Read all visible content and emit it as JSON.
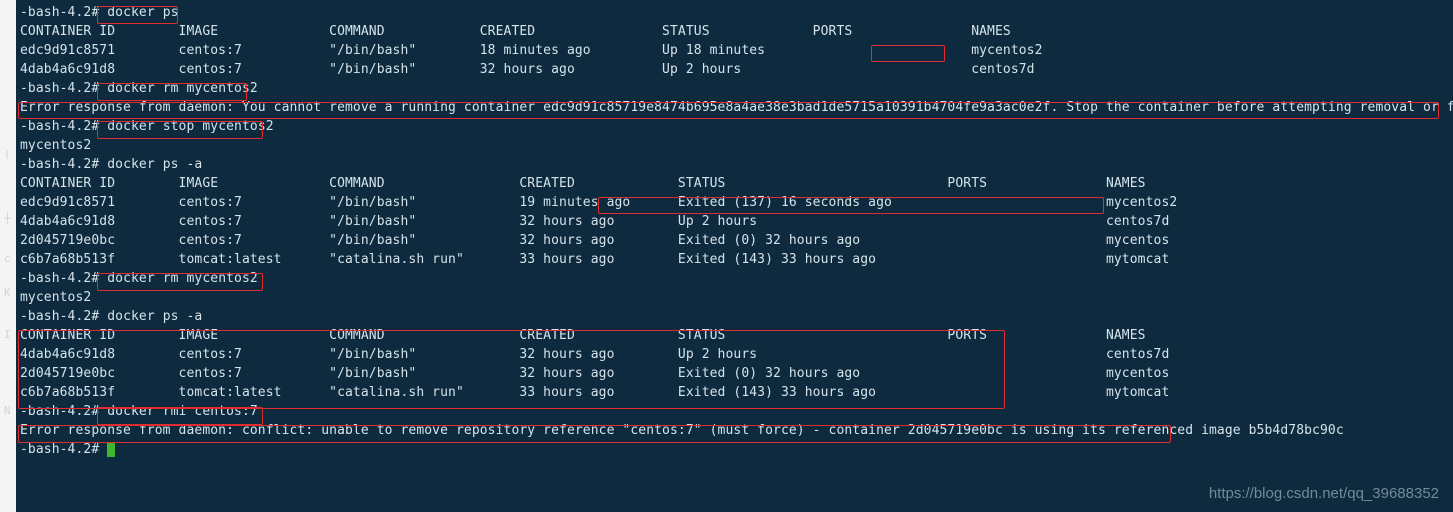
{
  "prompt": "-bash-4.2#",
  "commands": {
    "ps": "docker ps",
    "rm1": "docker rm mycentos2",
    "stop": "docker stop mycentos2",
    "psa1": "docker ps -a",
    "rm2": "docker rm mycentos2",
    "psa2": "docker ps -a",
    "rmi": "docker rmi centos:7"
  },
  "outputs": {
    "rm_stop_echo": "mycentos2",
    "err1": "Error response from daemon: You cannot remove a running container edc9d91c85719e8474b695e8a4ae38e3bad1de5715a10391b4704fe9a3ac0e2f. Stop the container before attempting removal or force remove",
    "err2": "Error response from daemon: conflict: unable to remove repository reference \"centos:7\" (must force) - container 2d045719e0bc is using its referenced image b5b4d78bc90c"
  },
  "columns1": {
    "c0": "CONTAINER ID",
    "c1": "IMAGE",
    "c2": "COMMAND",
    "c3": "CREATED",
    "c4": "STATUS",
    "c5": "PORTS",
    "c6": "NAMES"
  },
  "table1": [
    {
      "c0": "edc9d91c8571",
      "c1": "centos:7",
      "c2": "\"/bin/bash\"",
      "c3": "18 minutes ago",
      "c4": "Up 18 minutes",
      "c5": "",
      "c6": "mycentos2"
    },
    {
      "c0": "4dab4a6c91d8",
      "c1": "centos:7",
      "c2": "\"/bin/bash\"",
      "c3": "32 hours ago",
      "c4": "Up 2 hours",
      "c5": "",
      "c6": "centos7d"
    }
  ],
  "columns2": {
    "c0": "CONTAINER ID",
    "c1": "IMAGE",
    "c2": "COMMAND",
    "c3": "CREATED",
    "c4": "STATUS",
    "c5": "PORTS",
    "c6": "NAMES"
  },
  "table2": [
    {
      "c0": "edc9d91c8571",
      "c1": "centos:7",
      "c2": "\"/bin/bash\"",
      "c3": "19 minutes ago",
      "c4": "Exited (137) 16 seconds ago",
      "c5": "",
      "c6": "mycentos2"
    },
    {
      "c0": "4dab4a6c91d8",
      "c1": "centos:7",
      "c2": "\"/bin/bash\"",
      "c3": "32 hours ago",
      "c4": "Up 2 hours",
      "c5": "",
      "c6": "centos7d"
    },
    {
      "c0": "2d045719e0bc",
      "c1": "centos:7",
      "c2": "\"/bin/bash\"",
      "c3": "32 hours ago",
      "c4": "Exited (0) 32 hours ago",
      "c5": "",
      "c6": "mycentos"
    },
    {
      "c0": "c6b7a68b513f",
      "c1": "tomcat:latest",
      "c2": "\"catalina.sh run\"",
      "c3": "33 hours ago",
      "c4": "Exited (143) 33 hours ago",
      "c5": "",
      "c6": "mytomcat"
    }
  ],
  "columns3": {
    "c0": "CONTAINER ID",
    "c1": "IMAGE",
    "c2": "COMMAND",
    "c3": "CREATED",
    "c4": "STATUS",
    "c5": "PORTS",
    "c6": "NAMES"
  },
  "table3": [
    {
      "c0": "4dab4a6c91d8",
      "c1": "centos:7",
      "c2": "\"/bin/bash\"",
      "c3": "32 hours ago",
      "c4": "Up 2 hours",
      "c5": "",
      "c6": "centos7d"
    },
    {
      "c0": "2d045719e0bc",
      "c1": "centos:7",
      "c2": "\"/bin/bash\"",
      "c3": "32 hours ago",
      "c4": "Exited (0) 32 hours ago",
      "c5": "",
      "c6": "mycentos"
    },
    {
      "c0": "c6b7a68b513f",
      "c1": "tomcat:latest",
      "c2": "\"catalina.sh run\"",
      "c3": "33 hours ago",
      "c4": "Exited (143) 33 hours ago",
      "c5": "",
      "c6": "mytomcat"
    }
  ],
  "col_widths": {
    "A": {
      "c0": 20,
      "c1": 19,
      "c2": 19,
      "c3": 23,
      "c4": 19,
      "c5": 20,
      "c6": 0
    },
    "B": {
      "c0": 20,
      "c1": 19,
      "c2": 24,
      "c3": 20,
      "c4": 34,
      "c5": 20,
      "c6": 0
    }
  },
  "watermark": "https://blog.csdn.net/qq_39688352",
  "gutter_chars": [
    "(",
    "┼",
    "c",
    "K",
    "I",
    "N"
  ]
}
